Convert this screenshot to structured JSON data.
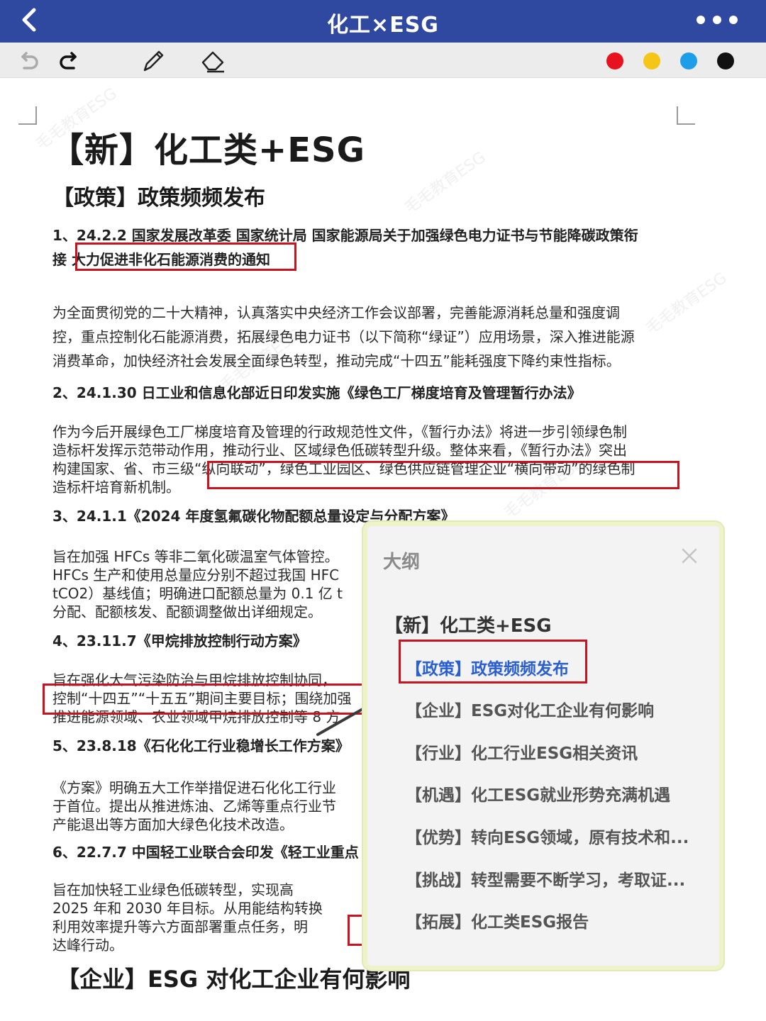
{
  "header": {
    "title": "化工×ESG"
  },
  "toolbar": {
    "tools": [
      "undo-icon",
      "redo-icon",
      "pen-icon",
      "eraser-icon"
    ],
    "colors": [
      "#e8121e",
      "#f5c518",
      "#1e9ee8",
      "#111111"
    ]
  },
  "doc": {
    "title": "【新】化工类+ESG",
    "section1": "【政策】政策频频发布",
    "items": [
      {
        "heading": [
          "1、24.2.2 国家发展改革委 国家统计局 国家能源局关于加强绿色电力证书与节能降碳政策衔",
          "接 大力促进非化石能源消费的通知"
        ],
        "body": [
          "为全面贯彻党的二十大精神，认真落实中央经济工作会议部署，完善能源消耗总量和强度调",
          "控，重点控制化石能源消费，拓展绿色电力证书（以下简称“绿证”）应用场景，深入推进能源",
          "消费革命，加快经济社会发展全面绿色转型，推动完成“十四五”能耗强度下降约束性指标。"
        ]
      },
      {
        "heading": [
          "2、24.1.30 日工业和信息化部近日印发实施《绿色工厂梯度培育及管理暂行办法》"
        ],
        "body": [
          "作为今后开展绿色工厂梯度培育及管理的行政规范性文件，《暂行办法》将进一步引领绿色制",
          "造标杆发挥示范带动作用，推动行业、区域绿色低碳转型升级。整体来看，《暂行办法》突出",
          "构建国家、省、市三级“纵向联动”，绿色工业园区、绿色供应链管理企业“横向带动”的绿色制",
          "造标杆培育新机制。"
        ]
      },
      {
        "heading": [
          "3、24.1.1《2024 年度氢氟碳化物配额总量设定与分配方案》"
        ],
        "body": [
          "旨在加强 HFCs 等非二氧化碳温室气体管控。",
          "HFCs 生产和使用总量应分别不超过我国 HFC",
          "tCO2）基线值；明确进口配额总量为 0.1 亿 t",
          "分配、配额核发、配额调整做出详细规定。"
        ]
      },
      {
        "heading": [
          "4、23.11.7《甲烷排放控制行动方案》"
        ],
        "body": [
          "旨在强化大气污染防治与甲烷排放控制协同，",
          "控制“十四五”“十五五”期间主要目标；围绕加强",
          "推进能源领域、农业领域甲烷排放控制等 8 方"
        ]
      },
      {
        "heading": [
          "5、23.8.18《石化化工行业稳增长工作方案》"
        ],
        "body": [
          "《方案》明确五大工作举措促进石化化工行业",
          "于首位。提出从推进炼油、乙烯等重点行业节",
          "产能退出等方面加大绿色化技术改造。"
        ]
      },
      {
        "heading": [
          "6、22.7.7 中国轻工业联合会印发《轻工业重点"
        ],
        "body": [
          "旨在加快轻工业绿色低碳转型，实现高",
          "2025 年和 2030 年目标。从用能结构转换",
          "利用效率提升等六方面部署重点任务，明",
          "达峰行动。"
        ]
      }
    ],
    "section2": "【企业】ESG 对化工企业有何影响",
    "watermark": "毛毛教育ESG"
  },
  "outline": {
    "title": "大纲",
    "root": "【新】化工类+ESG",
    "items": [
      "【政策】政策频频发布",
      "【企业】ESG对化工企业有何影响",
      "【行业】化工行业ESG相关资讯",
      "【机遇】化工ESG就业形势充满机遇",
      "【优势】转向ESG领域，原有技术和...",
      "【挑战】转型需要不断学习，考取证...",
      "【拓展】化工类ESG报告"
    ],
    "active_index": 0
  }
}
